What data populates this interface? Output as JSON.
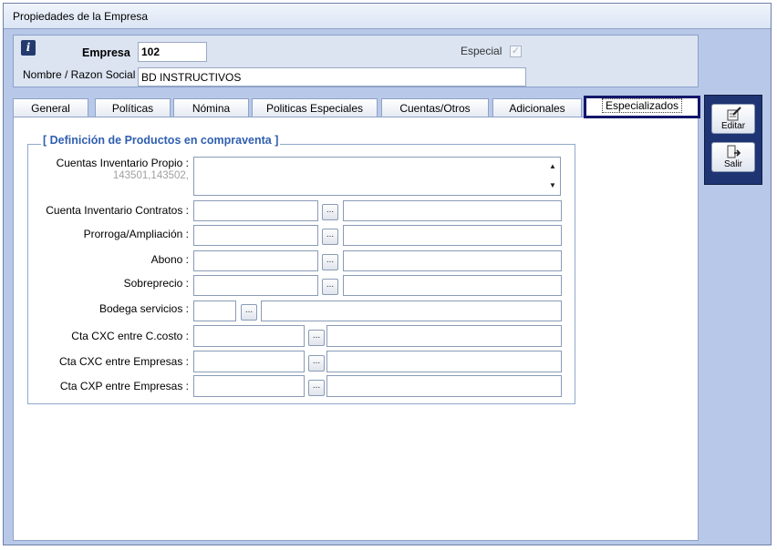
{
  "window": {
    "title": "Propiedades de la Empresa"
  },
  "header": {
    "empresa_label": "Empresa",
    "empresa_value": "102",
    "especial_label": "Especial",
    "especial_checked": true,
    "nombre_label": "Nombre / Razon Social",
    "nombre_value": "BD INSTRUCTIVOS"
  },
  "tabs": [
    {
      "label": "General"
    },
    {
      "label": "Políticas"
    },
    {
      "label": "Nómina"
    },
    {
      "label": "Politicas Especiales"
    },
    {
      "label": "Cuentas/Otros"
    },
    {
      "label": "Adicionales"
    },
    {
      "label": "Especializados",
      "active": true
    }
  ],
  "section": {
    "title": "[ Definición de Productos en compraventa ]",
    "fields": {
      "inventario_propio": {
        "label": "Cuentas Inventario Propio :",
        "hint": "143501,143502,"
      },
      "inventario_contratos": {
        "label": "Cuenta Inventario Contratos :"
      },
      "prorroga": {
        "label": "Prorroga/Ampliación :"
      },
      "abono": {
        "label": "Abono :"
      },
      "sobreprecio": {
        "label": "Sobreprecio :"
      },
      "bodega": {
        "label": "Bodega servicios :"
      },
      "cxc_ccosto": {
        "label": "Cta CXC entre C.costo :"
      },
      "cxc_empresas": {
        "label": "Cta CXC entre Empresas :"
      },
      "cxp_empresas": {
        "label": "Cta CXP entre Empresas :"
      }
    },
    "browse_label": "..."
  },
  "sidebar": {
    "editar_label": "Editar",
    "salir_label": "Salir"
  },
  "icons": {
    "info": "info-icon",
    "editar": "edit-icon",
    "salir": "exit-icon",
    "scroll_up": "▲",
    "scroll_down": "▼",
    "check": "✓"
  },
  "colors": {
    "window_bg": "#b8c8e8",
    "side_panel": "#1f3472",
    "section_title": "#2f5fb0",
    "active_tab_border": "#14176b"
  }
}
